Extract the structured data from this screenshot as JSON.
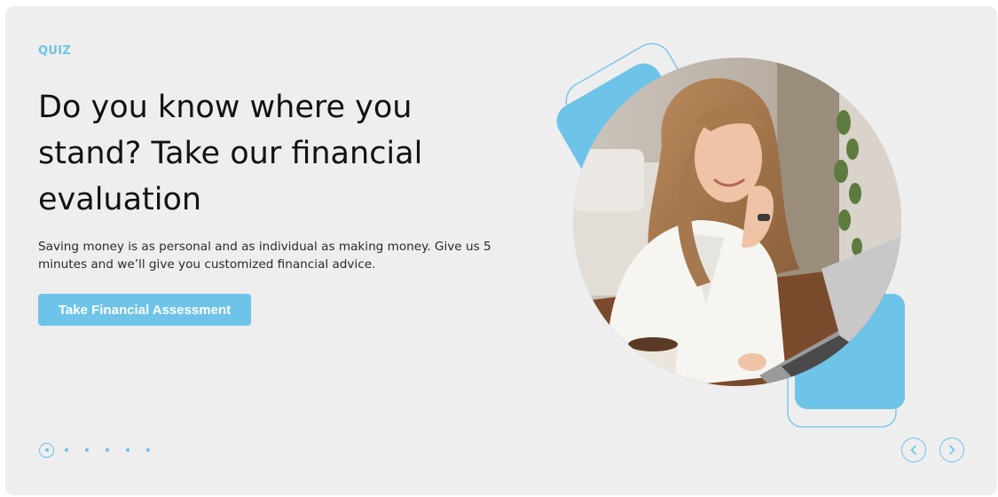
{
  "promo": {
    "eyebrow": "QUIZ",
    "headline": "Do you know where you stand? Take our financial evaluation",
    "body": "Saving money is as personal and as individual as making money. Give us 5 minutes and we’ll give you customized financial advice.",
    "cta_label": "Take Financial Assessment"
  },
  "carousel": {
    "slide_count": 6,
    "active_index": 0,
    "prev_icon": "chevron-left-icon",
    "next_icon": "chevron-right-icon"
  },
  "colors": {
    "accent": "#6ec3e9",
    "card_bg": "#eeeeee",
    "headline": "#121212"
  }
}
